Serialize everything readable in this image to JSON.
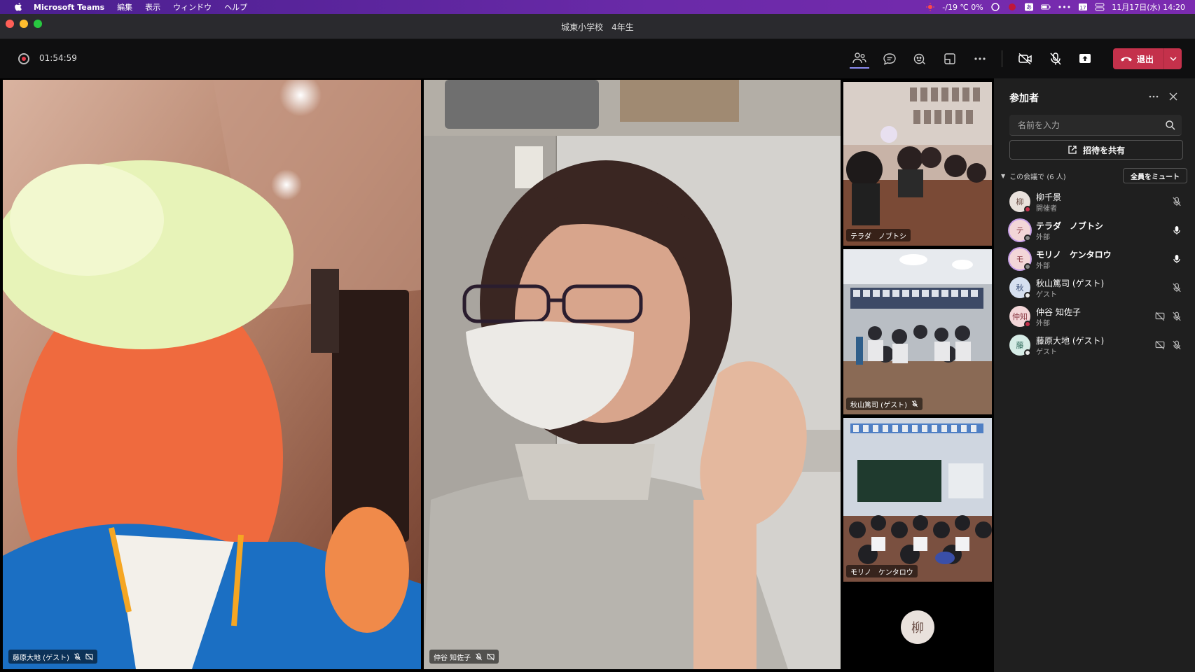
{
  "menubar": {
    "app_name": "Microsoft Teams",
    "items": [
      "編集",
      "表示",
      "ウィンドウ",
      "ヘルプ"
    ],
    "status_text": "-/19 ℃ 0%",
    "datetime": "11月17日(水) 14:20"
  },
  "window": {
    "title": "城東小学校　4年生"
  },
  "toolbar": {
    "timer": "01:54:59",
    "leave_label": "退出",
    "leave_color": "#c4314b"
  },
  "tiles": {
    "main_left": {
      "name": "藤原大地 (ゲスト)"
    },
    "main_center": {
      "name": "仲谷 知佐子"
    },
    "thumbs": [
      {
        "name": "テラダ　ノブトシ"
      },
      {
        "name": "秋山篤司 (ゲスト)"
      },
      {
        "name": "モリノ　ケンタロウ"
      }
    ]
  },
  "self_avatar": {
    "initial": "柳"
  },
  "panel": {
    "title": "参加者",
    "search_placeholder": "名前を入力",
    "share_label": "招待を共有",
    "section_label": "この会議で (6 人)",
    "mute_all_label": "全員をミュート",
    "participants": [
      {
        "initial": "柳",
        "name": "柳千景",
        "role": "開催者"
      },
      {
        "initial": "テ",
        "name": "テラダ　ノブトシ",
        "role": "外部"
      },
      {
        "initial": "モ",
        "name": "モリノ　ケンタロウ",
        "role": "外部"
      },
      {
        "initial": "秋",
        "name": "秋山篤司 (ゲスト)",
        "role": "ゲスト"
      },
      {
        "initial": "仲知",
        "name": "仲谷 知佐子",
        "role": "外部"
      },
      {
        "initial": "藤",
        "name": "藤原大地 (ゲスト)",
        "role": "ゲスト"
      }
    ]
  },
  "colors": {
    "accent": "#7f85f5",
    "panel_bg": "#1f1f1f",
    "toolbar_bg": "#0f0f10"
  }
}
